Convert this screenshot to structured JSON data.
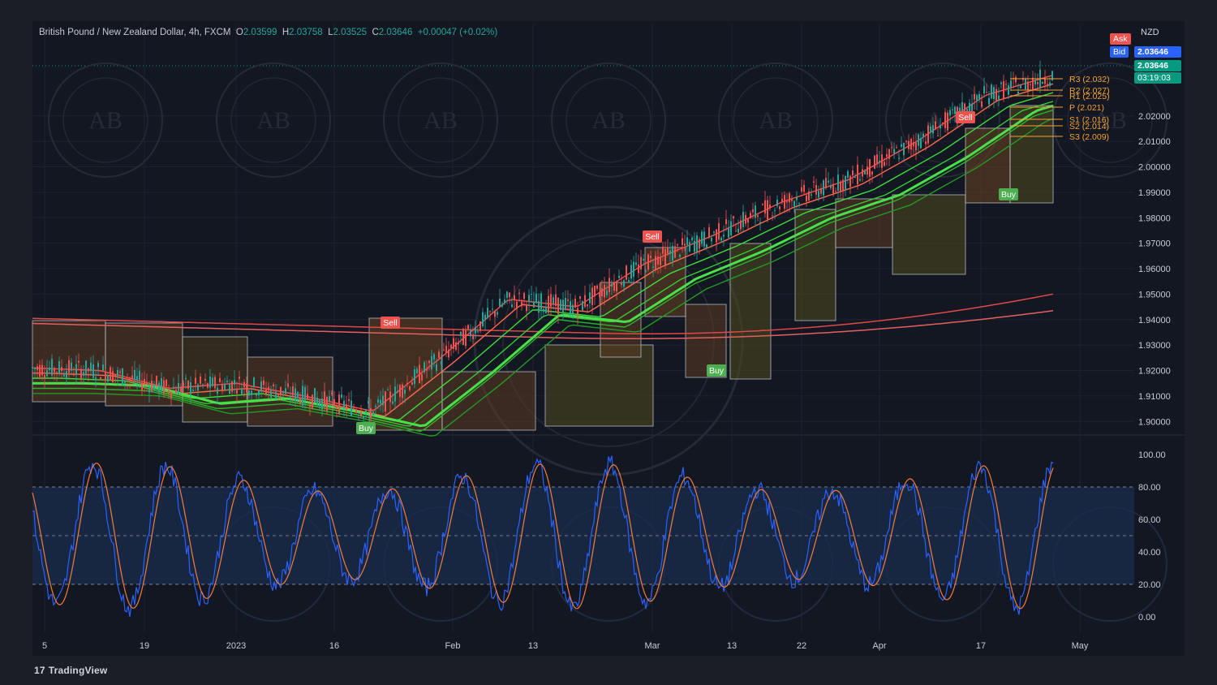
{
  "legend": {
    "symbol": "British Pound / New Zealand Dollar, 4h, FXCM",
    "o_label": "O",
    "o": "2.03599",
    "h_label": "H",
    "h": "2.03758",
    "l_label": "L",
    "l": "2.03525",
    "c_label": "C",
    "c": "2.03646",
    "change": "+0.00047 (+0.02%)"
  },
  "price_panel": {
    "currency": "NZD",
    "ask_label": "Ask",
    "bid_label": "Bid",
    "bid_value": "2.03646",
    "last_value": "2.03646",
    "countdown": "03:19:03",
    "ticks": [
      "2.02000",
      "2.01000",
      "2.00000",
      "1.99000",
      "1.98000",
      "1.97000",
      "1.96000",
      "1.95000",
      "1.94000",
      "1.93000",
      "1.92000",
      "1.91000",
      "1.90000"
    ]
  },
  "pivots": [
    "R3 (2.032)",
    "R2 (2.027)",
    "R1 (2.025)",
    "P (2.021)",
    "S1 (2.016)",
    "S2 (2.014)",
    "S3 (2.009)"
  ],
  "signals": [
    {
      "type": "Sell",
      "text": "Sell"
    },
    {
      "type": "Buy",
      "text": "Buy"
    },
    {
      "type": "Sell",
      "text": "Sell"
    },
    {
      "type": "Buy",
      "text": "Buy"
    },
    {
      "type": "Sell",
      "text": "Sell"
    },
    {
      "type": "Buy",
      "text": "Buy"
    }
  ],
  "osc_ticks": [
    "100.00",
    "80.00",
    "60.00",
    "40.00",
    "20.00",
    "0.00"
  ],
  "x_ticks": [
    "5",
    "19",
    "2023",
    "16",
    "Feb",
    "13",
    "Mar",
    "13",
    "22",
    "Apr",
    "17",
    "May"
  ],
  "footer": {
    "brand": "TradingView",
    "brand_mark": "17"
  },
  "colors": {
    "bg": "#131722",
    "up": "#26a69a",
    "down": "#ef5350",
    "pivot": "#f5a234",
    "ask": "#ef5350",
    "bid": "#2962ff",
    "osc_k": "#2962ff",
    "osc_d": "#f57c3b"
  },
  "chart_data": [
    {
      "type": "line",
      "title": "British Pound / New Zealand Dollar, 4h, FXCM",
      "x": [
        "5",
        "19",
        "2023",
        "16",
        "Feb",
        "13",
        "Mar",
        "13",
        "22",
        "Apr",
        "17",
        "May"
      ],
      "series": [
        {
          "values": [
            1.921,
            1.92,
            1.913,
            1.915,
            1.91,
            1.904,
            1.925,
            1.948,
            1.945,
            1.962,
            1.973,
            1.986,
            1.995,
            2.01,
            2.028,
            2.036
          ]
        }
      ],
      "ylim": [
        1.895,
        2.04
      ],
      "ylabel": "NZD"
    },
    {
      "type": "line",
      "series": [
        {
          "values": [
            80,
            20,
            95,
            15,
            90,
            10,
            85,
            25,
            100,
            5,
            92,
            18,
            88,
            12,
            96,
            30,
            90,
            10,
            95,
            60
          ]
        }
      ],
      "ylim": [
        0,
        100
      ],
      "bands": [
        20,
        80
      ]
    }
  ]
}
